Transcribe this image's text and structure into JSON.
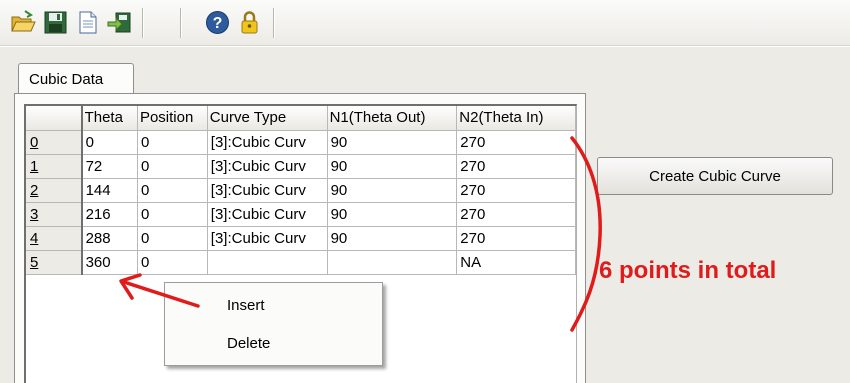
{
  "toolbar": {
    "buttons": [
      {
        "icon": "open-folder-icon"
      },
      {
        "icon": "save-icon"
      },
      {
        "icon": "new-document-icon"
      },
      {
        "icon": "export-icon"
      },
      {
        "icon": "help-icon"
      },
      {
        "icon": "lock-icon"
      }
    ]
  },
  "tab": {
    "label": "Cubic Data"
  },
  "grid": {
    "columns": [
      "",
      "Theta",
      "Position",
      "Curve Type",
      "N1(Theta Out)",
      "N2(Theta In)"
    ],
    "rows": [
      [
        "0",
        "0",
        "0",
        "[3]:Cubic Curv",
        "90",
        "270"
      ],
      [
        "1",
        "72",
        "0",
        "[3]:Cubic Curv",
        "90",
        "270"
      ],
      [
        "2",
        "144",
        "0",
        "[3]:Cubic Curv",
        "90",
        "270"
      ],
      [
        "3",
        "216",
        "0",
        "[3]:Cubic Curv",
        "90",
        "270"
      ],
      [
        "4",
        "288",
        "0",
        "[3]:Cubic Curv",
        "90",
        "270"
      ],
      [
        "5",
        "360",
        "0",
        "",
        "",
        "NA"
      ]
    ]
  },
  "create_button": {
    "label": "Create Cubic Curve"
  },
  "context_menu": {
    "items": [
      "Insert",
      "Delete"
    ]
  },
  "annotation": {
    "text": "6 points in total",
    "color": "#e01b1b"
  },
  "colors": {
    "toolbar_bg": "#ecebe6",
    "panel_bg": "#fcfcfb",
    "annotation": "#e01b1b"
  }
}
